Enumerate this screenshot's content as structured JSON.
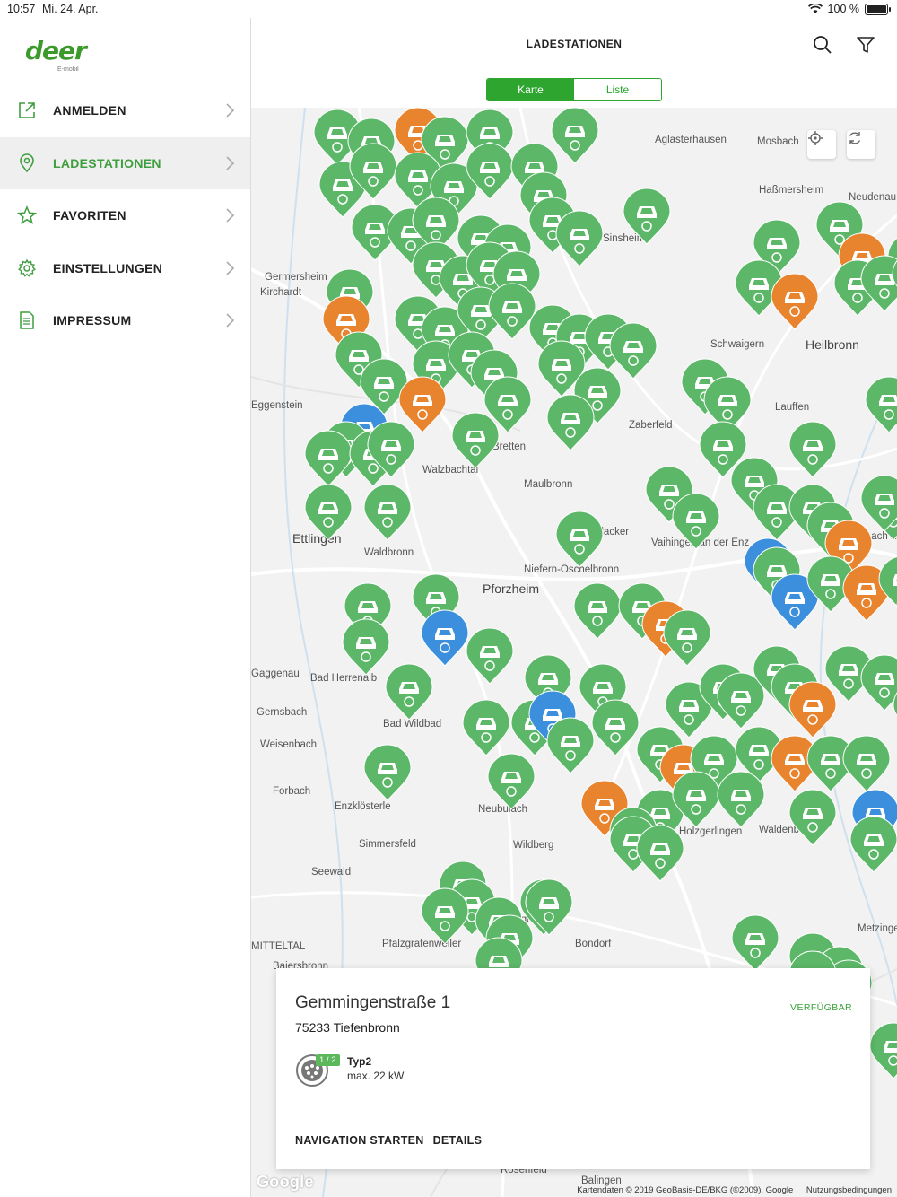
{
  "status_bar": {
    "time": "10:57",
    "date": "Mi. 24. Apr.",
    "battery": "100 %"
  },
  "app": {
    "logo_text": "deer",
    "logo_sub": "E-mobil"
  },
  "sidebar": {
    "items": [
      {
        "label": "ANMELDEN",
        "icon": "external-link-icon",
        "active": false
      },
      {
        "label": "LADESTATIONEN",
        "icon": "map-pin-icon",
        "active": true
      },
      {
        "label": "FAVORITEN",
        "icon": "star-icon",
        "active": false
      },
      {
        "label": "EINSTELLUNGEN",
        "icon": "gear-icon",
        "active": false
      },
      {
        "label": "IMPRESSUM",
        "icon": "document-icon",
        "active": false
      }
    ]
  },
  "header": {
    "title": "LADESTATIONEN",
    "segments": [
      "Karte",
      "Liste"
    ],
    "selected_segment": "Karte"
  },
  "map": {
    "places": [
      {
        "name": "Aglasterhausen"
      },
      {
        "name": "Mosbach"
      },
      {
        "name": "Sinsheim"
      },
      {
        "name": "Haßmersheim"
      },
      {
        "name": "Neudenau"
      },
      {
        "name": "Schwaigern"
      },
      {
        "name": "Heilbronn"
      },
      {
        "name": "Zaberfeld"
      },
      {
        "name": "Lauffen"
      },
      {
        "name": "Walzbachtal"
      },
      {
        "name": "Maulbronn"
      },
      {
        "name": "Mühlacker"
      },
      {
        "name": "Ettlingen"
      },
      {
        "name": "Waldbronn"
      },
      {
        "name": "Marbach am Neckar"
      },
      {
        "name": "Niefern-Öschelbronn"
      },
      {
        "name": "Pforzheim"
      },
      {
        "name": "Bad Herrenalb"
      },
      {
        "name": "Bad Wildbad"
      },
      {
        "name": "Gernsbach"
      },
      {
        "name": "Weisenbach"
      },
      {
        "name": "Forbach"
      },
      {
        "name": "Enzklösterle"
      },
      {
        "name": "Neubulach"
      },
      {
        "name": "Holzgerlingen"
      },
      {
        "name": "Waldenbuch"
      },
      {
        "name": "Simmersfeld"
      },
      {
        "name": "Wildberg"
      },
      {
        "name": "Seewald"
      },
      {
        "name": "Nagold"
      },
      {
        "name": "Pfalzgrafenweiler"
      },
      {
        "name": "Bondorf"
      },
      {
        "name": "Baiersbronn"
      },
      {
        "name": "MITTELTAL"
      },
      {
        "name": "Germersheim"
      },
      {
        "name": "Eggenstein"
      },
      {
        "name": "Gaggenau"
      },
      {
        "name": "Metzingen"
      },
      {
        "name": "Kirchardt"
      },
      {
        "name": "Vaihingen an der Enz"
      },
      {
        "name": "Bretten"
      },
      {
        "name": "Rosenfeld"
      },
      {
        "name": "Balingen"
      }
    ],
    "marker_colors": {
      "available": "#5cb868",
      "occupied": "#e8832e",
      "unknown": "#3b8fdc"
    },
    "attribution": "Kartendaten © 2019 GeoBasis-DE/BKG (©2009), Google",
    "terms": "Nutzungsbedingungen",
    "google": "Google"
  },
  "station_card": {
    "street": "Gemmingenstraße 1",
    "city": "75233 Tiefenbronn",
    "status": "VERFÜGBAR",
    "connector": {
      "count": "1 / 2",
      "type": "Typ2",
      "power": "max. 22 kW"
    },
    "actions": {
      "navigate": "NAVIGATION STARTEN",
      "details": "DETAILS"
    }
  }
}
